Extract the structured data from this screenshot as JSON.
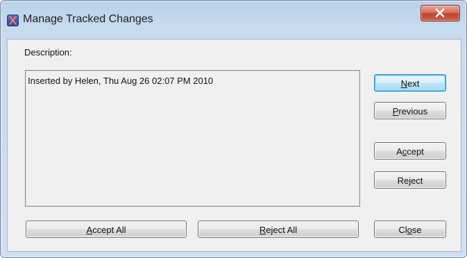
{
  "window": {
    "title": "Manage Tracked Changes",
    "app_icon": "x-app-icon",
    "close_icon": "close-icon"
  },
  "description": {
    "label": "Description:",
    "text": "Inserted by Helen, Thu Aug 26 02:07 PM 2010"
  },
  "buttons": {
    "next": {
      "pre": "",
      "key": "N",
      "post": "ext"
    },
    "previous": {
      "pre": "",
      "key": "P",
      "post": "revious"
    },
    "accept": {
      "pre": "A",
      "key": "c",
      "post": "cept"
    },
    "reject": {
      "pre": "Re",
      "key": "j",
      "post": "ect"
    },
    "accept_all": {
      "pre": "",
      "key": "A",
      "post": "ccept All"
    },
    "reject_all": {
      "pre": "",
      "key": "R",
      "post": "eject All"
    },
    "close": {
      "pre": "Cl",
      "key": "o",
      "post": "se"
    }
  },
  "colors": {
    "titlebar": "#b9d1ea",
    "close_button": "#c7402c",
    "dialog_bg": "#f0f0f0",
    "default_button_border": "#3c7fb1"
  }
}
